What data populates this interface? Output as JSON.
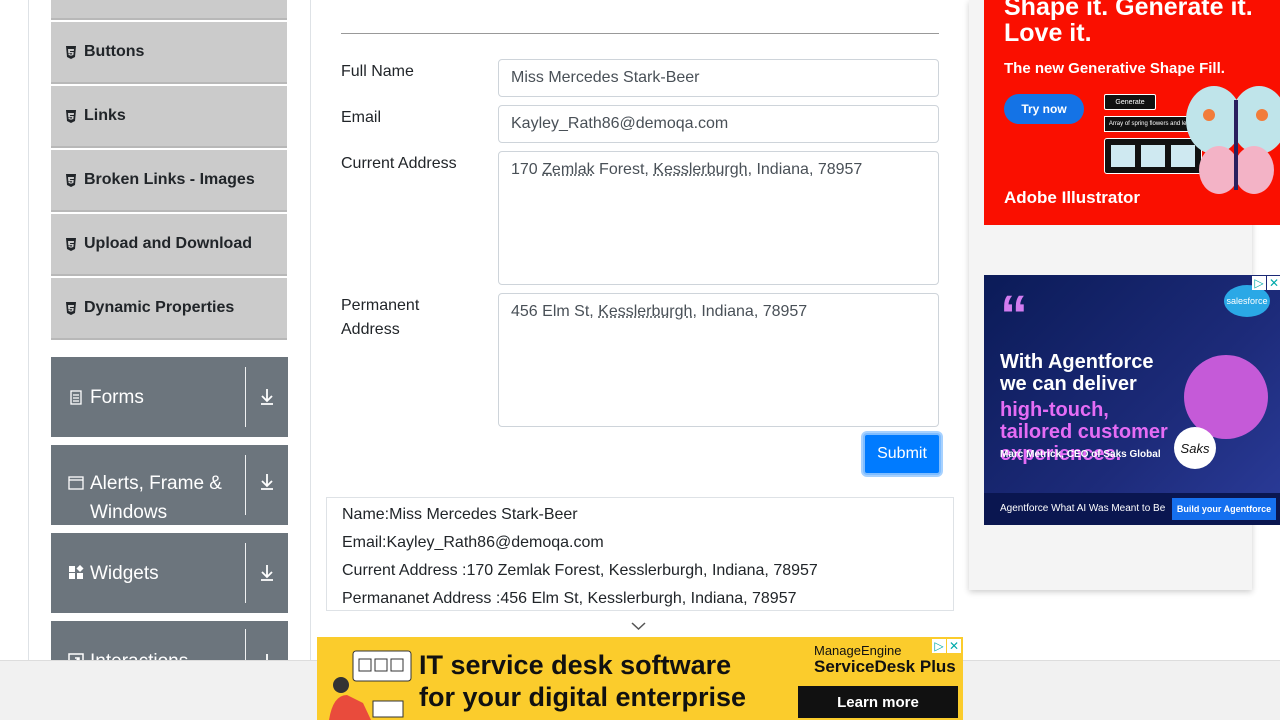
{
  "sidebar": {
    "elements_items": [
      "Buttons",
      "Links",
      "Broken Links - Images",
      "Upload and Download",
      "Dynamic Properties"
    ],
    "groups": [
      "Forms",
      "Alerts, Frame &",
      "Windows",
      "Widgets",
      "Interactions"
    ]
  },
  "form": {
    "full_name_label": "Full Name",
    "full_name_value": "Miss Mercedes Stark-Beer",
    "email_label": "Email",
    "email_value": "Kayley_Rath86@demoqa.com",
    "current_address_label": "Current Address",
    "current_address_parts": [
      "170 ",
      "Zemlak",
      " Forest, ",
      "Kesslerburgh",
      ", Indiana, 78957"
    ],
    "permanent_address_label_1": "Permanent",
    "permanent_address_label_2": "Address",
    "permanent_address_parts": [
      "456 Elm St, ",
      "Kesslerburgh",
      ", Indiana, 78957"
    ],
    "submit_label": "Submit"
  },
  "output": {
    "name": "Name:Miss Mercedes Stark-Beer",
    "email": "Email:Kayley_Rath86@demoqa.com",
    "current_address": "Current Address :170 Zemlak Forest, Kesslerburgh, Indiana, 78957",
    "permanent_address": "Permananet Address :456 Elm St, Kesslerburgh, Indiana, 78957"
  },
  "ads": {
    "adobe_title_1": "Shape it. Generate it.",
    "adobe_title_2": "Love it.",
    "adobe_sub": "The new Generative Shape Fill.",
    "adobe_button": "Try now",
    "adobe_generate": "Generate",
    "adobe_prompt": "Array of spring flowers and leaves",
    "adobe_logo": "Adobe Illustrator",
    "sf_quote": "“",
    "sf_line1": "With Agentforce",
    "sf_line2": "we can deliver",
    "sf_line3": "high-touch,",
    "sf_line4": "tailored customer",
    "sf_line5": "experiences.",
    "sf_who": "Marc Metrick, CEO of Saks Global",
    "sf_foot": "Agentforce  What AI Was Meant to Be",
    "sf_button": "Build your Agentforce",
    "sf_logo": "salesforce",
    "saks_logo": "Saks",
    "me_line1": "IT service desk software",
    "me_line2": "for your digital enterprise",
    "me_brand_1": "ManageEngine",
    "me_brand_2": "ServiceDesk Plus",
    "me_button": "Learn more"
  },
  "colors": {
    "sidebar_item_bg": "#cbcbcb",
    "group_bg": "#6c757d",
    "submit_bg": "#007bff",
    "adobe_red": "#fa0f00",
    "manageengine_yellow": "#fbcc2c"
  }
}
